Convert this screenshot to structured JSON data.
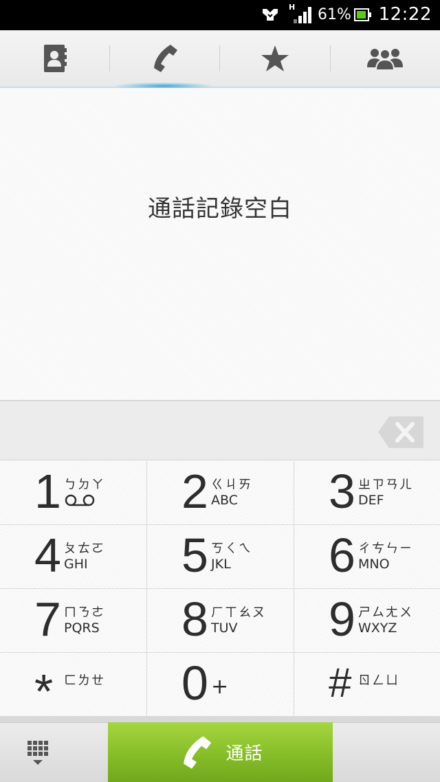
{
  "status_bar": {
    "network_type": "H",
    "battery_percent": "61%",
    "time": "12:22",
    "battery_color": "#5fc81c"
  },
  "tabs": [
    {
      "icon": "contacts-icon",
      "selected": false
    },
    {
      "icon": "phone-icon",
      "selected": true
    },
    {
      "icon": "star-icon",
      "selected": false
    },
    {
      "icon": "groups-icon",
      "selected": false
    }
  ],
  "call_log": {
    "empty_message": "通話記錄空白"
  },
  "keypad": {
    "keys": [
      {
        "digit": "1",
        "zhuyin": "ㄅㄉㄚ",
        "letters": "",
        "extra_icon": "voicemail-icon"
      },
      {
        "digit": "2",
        "zhuyin": "ㄍㄐㄞ",
        "letters": "ABC"
      },
      {
        "digit": "3",
        "zhuyin": "ㄓㄗㄢㄦ",
        "letters": "DEF"
      },
      {
        "digit": "4",
        "zhuyin": "ㄆㄊㄛ",
        "letters": "GHI"
      },
      {
        "digit": "5",
        "zhuyin": "ㄎㄑㄟ",
        "letters": "JKL"
      },
      {
        "digit": "6",
        "zhuyin": "ㄔㄘㄣㄧ",
        "letters": "MNO"
      },
      {
        "digit": "7",
        "zhuyin": "ㄇㄋㄜ",
        "letters": "PQRS"
      },
      {
        "digit": "8",
        "zhuyin": "ㄏㄒㄠㄡ",
        "letters": "TUV"
      },
      {
        "digit": "9",
        "zhuyin": "ㄕㄙㄤㄨ",
        "letters": "WXYZ"
      },
      {
        "digit": "*",
        "zhuyin": "ㄈㄌㄝ",
        "letters": ""
      },
      {
        "digit": "0",
        "zhuyin": "",
        "letters": "",
        "symbol": "+"
      },
      {
        "digit": "#",
        "zhuyin": "ㄖㄥㄩ",
        "letters": ""
      }
    ]
  },
  "bottom_bar": {
    "call_label": "通話",
    "call_color": "#8bc22c"
  }
}
